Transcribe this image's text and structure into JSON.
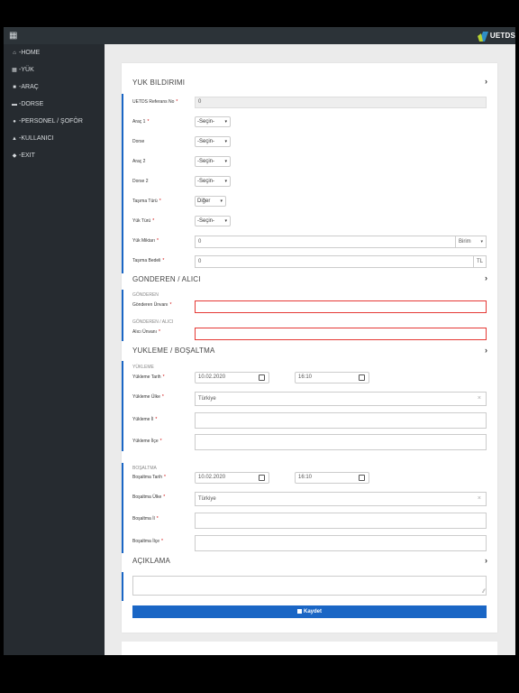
{
  "topbar": {
    "menu_icon": "grid-icon",
    "brand": "UETDS"
  },
  "sidebar": {
    "items": [
      {
        "label": "HOME",
        "icon": "home-icon"
      },
      {
        "label": "YÜK",
        "icon": "boxes-icon"
      },
      {
        "label": "ARAÇ",
        "icon": "truck-icon"
      },
      {
        "label": "DORSE",
        "icon": "trailer-icon"
      },
      {
        "label": "PERSONEL / ŞOFÖR",
        "icon": "users-icon"
      },
      {
        "label": "KULLANICI",
        "icon": "user-icon"
      },
      {
        "label": "EXIT",
        "icon": "exit-icon"
      }
    ]
  },
  "yuk": {
    "title": "YUK BILDIRIMI",
    "ref_label": "UETDS Referans No",
    "ref_value": "0",
    "arac1_label": "Araç 1",
    "arac1_value": "-Seçin-",
    "dorse_label": "Dorse",
    "dorse_value": "-Seçin-",
    "arac2_label": "Araç 2",
    "arac2_value": "-Seçin-",
    "dorse2_label": "Dorse 2",
    "dorse2_value": "-Seçin-",
    "tasima_turu_label": "Taşıma Türü",
    "tasima_turu_value": "Diğer",
    "yuk_turu_label": "Yük Türü",
    "yuk_turu_value": "-Seçin-",
    "yuk_miktari_label": "Yük Miktarı",
    "yuk_miktari_value": "0",
    "birim_value": "Birim",
    "tasima_bedeli_label": "Taşıma Bedeli",
    "tasima_bedeli_value": "0",
    "currency": "TL"
  },
  "gonderen": {
    "title": "GONDEREN / ALICI",
    "sub1": "GÖNDEREN",
    "gonderen_label": "Gönderen Ünvanı",
    "sub2": "GÖNDEREN / ALICI",
    "alici_label": "Alıcı Ünvanı"
  },
  "yukleme": {
    "title": "YUKLEME / BOŞALTMA",
    "sub1": "YÜKLEME",
    "yukleme_tarih_label": "Yükleme Tarih",
    "yukleme_tarih": "10.02.2020",
    "yukleme_saat": "16:10",
    "yukleme_ulke_label": "Yükleme Ülke",
    "yukleme_ulke": "Türkiye",
    "yukleme_il_label": "Yükleme İl",
    "yukleme_ilce_label": "Yükleme İlçe",
    "sub2": "BOŞALTMA",
    "bosaltma_tarih_label": "Boşaltma Tarih",
    "bosaltma_tarih": "10.02.2020",
    "bosaltma_saat": "16:10",
    "bosaltma_ulke_label": "Boşaltma Ülke",
    "bosaltma_ulke": "Türkiye",
    "bosaltma_il_label": "Boşaltma İl",
    "bosaltma_ilce_label": "Boşaltma İlçe"
  },
  "aciklama": {
    "title": "AÇIKLAMA"
  },
  "save_label": "Kaydet",
  "req": "*",
  "chevron": "›",
  "caret": "▾",
  "clear": "×",
  "colors": {
    "accent": "#1a66c5",
    "error": "#e53935",
    "sidebar": "#262b30"
  }
}
